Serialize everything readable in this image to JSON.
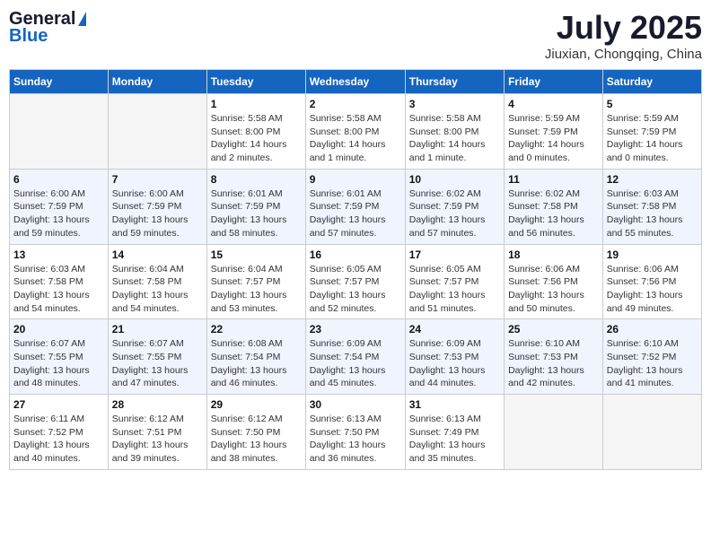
{
  "logo": {
    "general": "General",
    "blue": "Blue"
  },
  "title": {
    "month_year": "July 2025",
    "location": "Jiuxian, Chongqing, China"
  },
  "headers": [
    "Sunday",
    "Monday",
    "Tuesday",
    "Wednesday",
    "Thursday",
    "Friday",
    "Saturday"
  ],
  "weeks": [
    [
      {
        "day": "",
        "info": ""
      },
      {
        "day": "",
        "info": ""
      },
      {
        "day": "1",
        "info": "Sunrise: 5:58 AM\nSunset: 8:00 PM\nDaylight: 14 hours\nand 2 minutes."
      },
      {
        "day": "2",
        "info": "Sunrise: 5:58 AM\nSunset: 8:00 PM\nDaylight: 14 hours\nand 1 minute."
      },
      {
        "day": "3",
        "info": "Sunrise: 5:58 AM\nSunset: 8:00 PM\nDaylight: 14 hours\nand 1 minute."
      },
      {
        "day": "4",
        "info": "Sunrise: 5:59 AM\nSunset: 7:59 PM\nDaylight: 14 hours\nand 0 minutes."
      },
      {
        "day": "5",
        "info": "Sunrise: 5:59 AM\nSunset: 7:59 PM\nDaylight: 14 hours\nand 0 minutes."
      }
    ],
    [
      {
        "day": "6",
        "info": "Sunrise: 6:00 AM\nSunset: 7:59 PM\nDaylight: 13 hours\nand 59 minutes."
      },
      {
        "day": "7",
        "info": "Sunrise: 6:00 AM\nSunset: 7:59 PM\nDaylight: 13 hours\nand 59 minutes."
      },
      {
        "day": "8",
        "info": "Sunrise: 6:01 AM\nSunset: 7:59 PM\nDaylight: 13 hours\nand 58 minutes."
      },
      {
        "day": "9",
        "info": "Sunrise: 6:01 AM\nSunset: 7:59 PM\nDaylight: 13 hours\nand 57 minutes."
      },
      {
        "day": "10",
        "info": "Sunrise: 6:02 AM\nSunset: 7:59 PM\nDaylight: 13 hours\nand 57 minutes."
      },
      {
        "day": "11",
        "info": "Sunrise: 6:02 AM\nSunset: 7:58 PM\nDaylight: 13 hours\nand 56 minutes."
      },
      {
        "day": "12",
        "info": "Sunrise: 6:03 AM\nSunset: 7:58 PM\nDaylight: 13 hours\nand 55 minutes."
      }
    ],
    [
      {
        "day": "13",
        "info": "Sunrise: 6:03 AM\nSunset: 7:58 PM\nDaylight: 13 hours\nand 54 minutes."
      },
      {
        "day": "14",
        "info": "Sunrise: 6:04 AM\nSunset: 7:58 PM\nDaylight: 13 hours\nand 54 minutes."
      },
      {
        "day": "15",
        "info": "Sunrise: 6:04 AM\nSunset: 7:57 PM\nDaylight: 13 hours\nand 53 minutes."
      },
      {
        "day": "16",
        "info": "Sunrise: 6:05 AM\nSunset: 7:57 PM\nDaylight: 13 hours\nand 52 minutes."
      },
      {
        "day": "17",
        "info": "Sunrise: 6:05 AM\nSunset: 7:57 PM\nDaylight: 13 hours\nand 51 minutes."
      },
      {
        "day": "18",
        "info": "Sunrise: 6:06 AM\nSunset: 7:56 PM\nDaylight: 13 hours\nand 50 minutes."
      },
      {
        "day": "19",
        "info": "Sunrise: 6:06 AM\nSunset: 7:56 PM\nDaylight: 13 hours\nand 49 minutes."
      }
    ],
    [
      {
        "day": "20",
        "info": "Sunrise: 6:07 AM\nSunset: 7:55 PM\nDaylight: 13 hours\nand 48 minutes."
      },
      {
        "day": "21",
        "info": "Sunrise: 6:07 AM\nSunset: 7:55 PM\nDaylight: 13 hours\nand 47 minutes."
      },
      {
        "day": "22",
        "info": "Sunrise: 6:08 AM\nSunset: 7:54 PM\nDaylight: 13 hours\nand 46 minutes."
      },
      {
        "day": "23",
        "info": "Sunrise: 6:09 AM\nSunset: 7:54 PM\nDaylight: 13 hours\nand 45 minutes."
      },
      {
        "day": "24",
        "info": "Sunrise: 6:09 AM\nSunset: 7:53 PM\nDaylight: 13 hours\nand 44 minutes."
      },
      {
        "day": "25",
        "info": "Sunrise: 6:10 AM\nSunset: 7:53 PM\nDaylight: 13 hours\nand 42 minutes."
      },
      {
        "day": "26",
        "info": "Sunrise: 6:10 AM\nSunset: 7:52 PM\nDaylight: 13 hours\nand 41 minutes."
      }
    ],
    [
      {
        "day": "27",
        "info": "Sunrise: 6:11 AM\nSunset: 7:52 PM\nDaylight: 13 hours\nand 40 minutes."
      },
      {
        "day": "28",
        "info": "Sunrise: 6:12 AM\nSunset: 7:51 PM\nDaylight: 13 hours\nand 39 minutes."
      },
      {
        "day": "29",
        "info": "Sunrise: 6:12 AM\nSunset: 7:50 PM\nDaylight: 13 hours\nand 38 minutes."
      },
      {
        "day": "30",
        "info": "Sunrise: 6:13 AM\nSunset: 7:50 PM\nDaylight: 13 hours\nand 36 minutes."
      },
      {
        "day": "31",
        "info": "Sunrise: 6:13 AM\nSunset: 7:49 PM\nDaylight: 13 hours\nand 35 minutes."
      },
      {
        "day": "",
        "info": ""
      },
      {
        "day": "",
        "info": ""
      }
    ]
  ]
}
